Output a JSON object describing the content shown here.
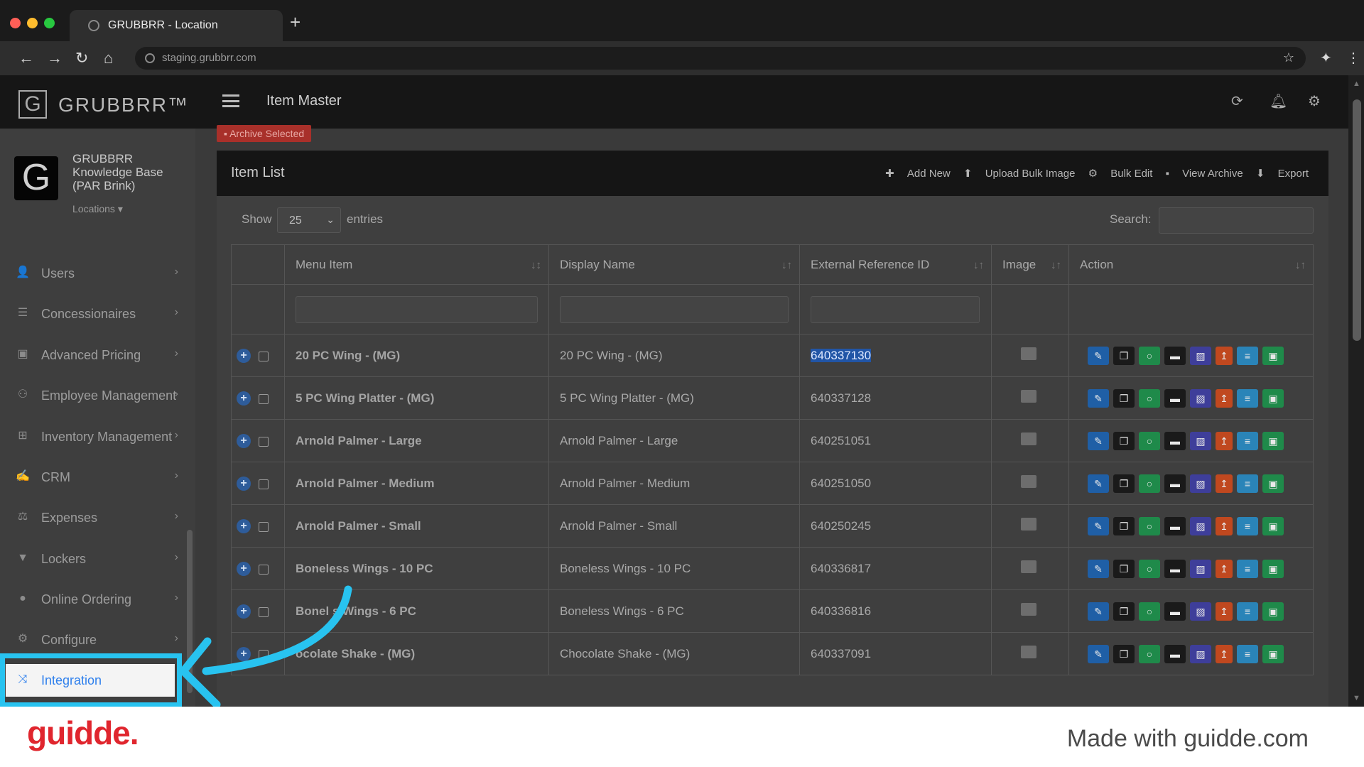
{
  "browser": {
    "tab_title": "GRUBBRR - Location",
    "url": "staging.grubbrr.com"
  },
  "brand": {
    "name": "GRUBBRR™",
    "logo_letter": "G"
  },
  "profile": {
    "name": "GRUBBRR Knowledge Base (PAR Brink)",
    "locations_label": "Locations ▾"
  },
  "sidebar": {
    "items": [
      {
        "label": "Users",
        "icon": "users-icon"
      },
      {
        "label": "Concessionaires",
        "icon": "list-icon"
      },
      {
        "label": "Advanced Pricing",
        "icon": "money-icon"
      },
      {
        "label": "Employee Management",
        "icon": "group-icon"
      },
      {
        "label": "Inventory Management",
        "icon": "sitemap-icon"
      },
      {
        "label": "CRM",
        "icon": "handshake-icon"
      },
      {
        "label": "Expenses",
        "icon": "scale-icon"
      },
      {
        "label": "Lockers",
        "icon": "lock-icon"
      },
      {
        "label": "Online Ordering",
        "icon": "globe-icon"
      },
      {
        "label": "Configure",
        "icon": "gear-icon"
      },
      {
        "label": "Integration",
        "icon": "integration-icon"
      }
    ]
  },
  "header": {
    "title": "Item Master"
  },
  "archive_button": "Archive Selected",
  "panel": {
    "title": "Item List",
    "actions": [
      "Add New",
      "Upload Bulk Image",
      "Bulk Edit",
      "View Archive",
      "Export"
    ]
  },
  "controls": {
    "show": "Show",
    "entries_value": "25",
    "entries": "entries",
    "search": "Search:"
  },
  "table": {
    "columns": [
      "Menu Item",
      "Display Name",
      "External Reference ID",
      "Image",
      "Action"
    ],
    "rows": [
      {
        "menu_item": "20 PC Wing - (MG)",
        "display_name": "20 PC Wing - (MG)",
        "ext_id": "640337130",
        "selected": true
      },
      {
        "menu_item": "5 PC Wing Platter - (MG)",
        "display_name": "5 PC Wing Platter - (MG)",
        "ext_id": "640337128"
      },
      {
        "menu_item": "Arnold Palmer - Large",
        "display_name": "Arnold Palmer - Large",
        "ext_id": "640251051"
      },
      {
        "menu_item": "Arnold Palmer - Medium",
        "display_name": "Arnold Palmer - Medium",
        "ext_id": "640251050"
      },
      {
        "menu_item": "Arnold Palmer - Small",
        "display_name": "Arnold Palmer - Small",
        "ext_id": "640250245"
      },
      {
        "menu_item": "Boneless Wings - 10 PC",
        "display_name": "Boneless Wings - 10 PC",
        "ext_id": "640336817"
      },
      {
        "menu_item": "Bonel s Wings - 6 PC",
        "display_name": "Boneless Wings - 6 PC",
        "ext_id": "640336816"
      },
      {
        "menu_item": "ocolate Shake - (MG)",
        "display_name": "Chocolate Shake - (MG)",
        "ext_id": "640337091"
      }
    ]
  },
  "action_colors": [
    "#1f5fa6",
    "#1a1a1a",
    "#1f8a4a",
    "#1a1a1a",
    "#3e3e9a",
    "#c0481f",
    "#2a84b8",
    "#1f8a4a"
  ],
  "footer": {
    "logo": "guidde.",
    "tagline": "Made with guidde.com"
  }
}
